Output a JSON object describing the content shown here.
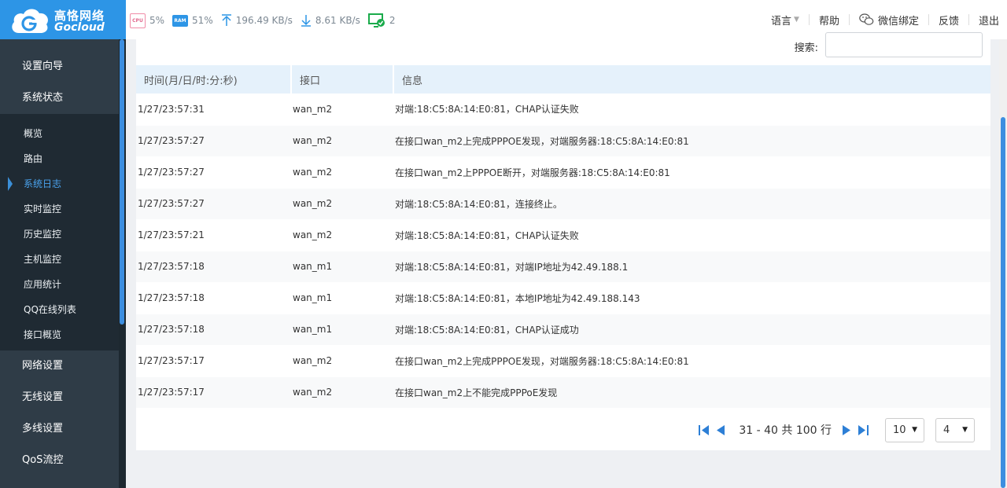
{
  "brand": {
    "name_cn": "高恪网络",
    "name_en": "Gocloud",
    "color": "#2d95e6"
  },
  "stats": {
    "cpu_chip": "CPU",
    "cpu": "5%",
    "ram_chip": "RAM",
    "ram": "51%",
    "upload": "196.49 KB/s",
    "download": "8.61 KB/s",
    "online": "2"
  },
  "topnav": {
    "language": "语言",
    "help": "帮助",
    "wechat": "微信绑定",
    "feedback": "反馈",
    "logout": "退出"
  },
  "sidebar": {
    "top": [
      "设置向导",
      "系统状态"
    ],
    "sub": [
      "概览",
      "路由",
      "系统日志",
      "实时监控",
      "历史监控",
      "主机监控",
      "应用统计",
      "QQ在线列表",
      "接口概览"
    ],
    "active_index": 2,
    "bottom": [
      "网络设置",
      "无线设置",
      "多线设置",
      "QoS流控"
    ]
  },
  "search": {
    "label": "搜索:",
    "value": ""
  },
  "table": {
    "headers": [
      "时间(月/日/时:分:秒)",
      "接口",
      "信息"
    ],
    "rows": [
      [
        "1/27/23:57:31",
        "wan_m2",
        "对端:18:C5:8A:14:E0:81，CHAP认证失败"
      ],
      [
        "1/27/23:57:27",
        "wan_m2",
        "在接口wan_m2上完成PPPOE发现，对端服务器:18:C5:8A:14:E0:81"
      ],
      [
        "1/27/23:57:27",
        "wan_m2",
        "在接口wan_m2上PPPOE断开，对端服务器:18:C5:8A:14:E0:81"
      ],
      [
        "1/27/23:57:27",
        "wan_m2",
        "对端:18:C5:8A:14:E0:81，连接终止。"
      ],
      [
        "1/27/23:57:21",
        "wan_m2",
        "对端:18:C5:8A:14:E0:81，CHAP认证失败"
      ],
      [
        "1/27/23:57:18",
        "wan_m1",
        "对端:18:C5:8A:14:E0:81，对端IP地址为42.49.188.1"
      ],
      [
        "1/27/23:57:18",
        "wan_m1",
        "对端:18:C5:8A:14:E0:81，本地IP地址为42.49.188.143"
      ],
      [
        "1/27/23:57:18",
        "wan_m1",
        "对端:18:C5:8A:14:E0:81，CHAP认证成功"
      ],
      [
        "1/27/23:57:17",
        "wan_m2",
        "在接口wan_m2上完成PPPOE发现，对端服务器:18:C5:8A:14:E0:81"
      ],
      [
        "1/27/23:57:17",
        "wan_m2",
        "在接口wan_m2上不能完成PPPoE发现"
      ]
    ]
  },
  "pager": {
    "info": "31 - 40 共 100 行",
    "page_size": "10",
    "page": "4"
  }
}
